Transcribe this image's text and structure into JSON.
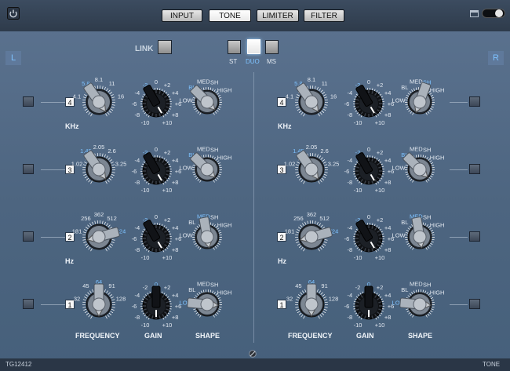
{
  "tabs": [
    {
      "label": "INPUT",
      "active": false
    },
    {
      "label": "TONE",
      "active": true
    },
    {
      "label": "LIMITER",
      "active": false
    },
    {
      "label": "FILTER",
      "active": false
    }
  ],
  "link_label": "LINK",
  "stereo_modes": {
    "options": [
      "ST",
      "DUO",
      "MS"
    ],
    "selected": "DUO"
  },
  "channels": {
    "left": "L",
    "right": "R"
  },
  "bands": [
    {
      "number": "4",
      "unit": "KHz",
      "freq_ticks": [
        "4.1",
        "5.8",
        "8.1",
        "11",
        "16"
      ],
      "freq_selected": "5.8"
    },
    {
      "number": "3",
      "unit": "",
      "freq_ticks": [
        "1.02",
        "1.45",
        "2.05",
        "2.6",
        "3.25"
      ],
      "freq_selected": "1.45"
    },
    {
      "number": "2",
      "unit": "Hz",
      "freq_ticks": [
        "181",
        "256",
        "362",
        "512",
        "724"
      ],
      "freq_selected": "724"
    },
    {
      "number": "1",
      "unit": "",
      "freq_ticks": [
        "32",
        "45",
        "64",
        "91",
        "128"
      ],
      "freq_selected": "64"
    }
  ],
  "gain_ticks": [
    "-10",
    "-8",
    "-6",
    "-4",
    "-2",
    "0",
    "+2",
    "+4",
    "+6",
    "+8",
    "+10"
  ],
  "shape_ticks": [
    "LOW",
    "BL",
    "MED",
    "SH",
    "HIGH"
  ],
  "left_state": [
    {
      "gain": "-2",
      "shape": "BL"
    },
    {
      "gain": "-2",
      "shape": "BL"
    },
    {
      "gain": "-2",
      "shape": "MED"
    },
    {
      "gain": "0",
      "shape": "LOW"
    }
  ],
  "right_state": [
    {
      "gain": "-2",
      "shape": "SH"
    },
    {
      "gain": "-2",
      "shape": "BL"
    },
    {
      "gain": "-2",
      "shape": "MED"
    },
    {
      "gain": "0",
      "shape": "LOW"
    }
  ],
  "column_labels": {
    "frequency": "FREQUENCY",
    "gain": "GAIN",
    "shape": "SHAPE"
  },
  "footer": {
    "serial": "TG12412",
    "page": "TONE"
  },
  "icons": {
    "power": "power-icon",
    "window": "window-icon",
    "toggle": "toggle-icon",
    "screw": "screw-icon",
    "speaker": "speaker-icon"
  },
  "colors": {
    "accent_blue": "#7ec2ff",
    "panel": "#52698a",
    "top_bar": "#313e4f"
  }
}
